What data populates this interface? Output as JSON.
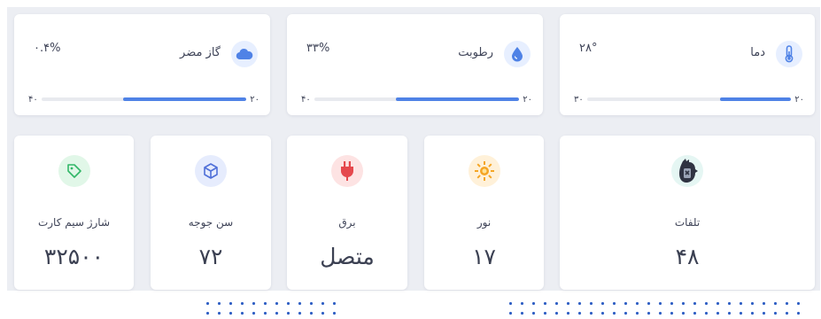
{
  "sensors": [
    {
      "title": "دما",
      "value": "۲۸°",
      "min": "۲۰",
      "max": "۳۰",
      "level": 0.35,
      "icon": "thermometer-icon",
      "color": "#4f82e6",
      "icon_bg": "#e7efff"
    },
    {
      "title": "رطوبت",
      "value": "۳۳%",
      "min": "۲۰",
      "max": "۴۰",
      "level": 0.6,
      "icon": "water-drop-icon",
      "color": "#4f82e6",
      "icon_bg": "#e7efff"
    },
    {
      "title": "گاز مضر",
      "value": "۰.۴%",
      "min": "۲۰",
      "max": "۴۰",
      "level": 0.6,
      "icon": "cloud-icon",
      "color": "#4f82e6",
      "icon_bg": "#e7efff"
    }
  ],
  "stats": [
    {
      "label": "تلفات",
      "value": "۴۸",
      "icon": "dead-chicken-icon",
      "icon_bg": "#e5f6f3"
    },
    {
      "label": "نور",
      "value": "۱۷",
      "icon": "sun-icon",
      "icon_bg": "#fff1d9"
    },
    {
      "label": "برق",
      "value": "متصل",
      "icon": "power-plug-icon",
      "icon_bg": "#fde3e3"
    },
    {
      "label": "سن جوجه",
      "value": "۷۲",
      "icon": "cube-icon",
      "icon_bg": "#e6ecfd"
    },
    {
      "label": "شارژ سیم کارت",
      "value": "۳۲۵۰۰",
      "icon": "tag-icon",
      "icon_bg": "#e1f7e8"
    }
  ]
}
